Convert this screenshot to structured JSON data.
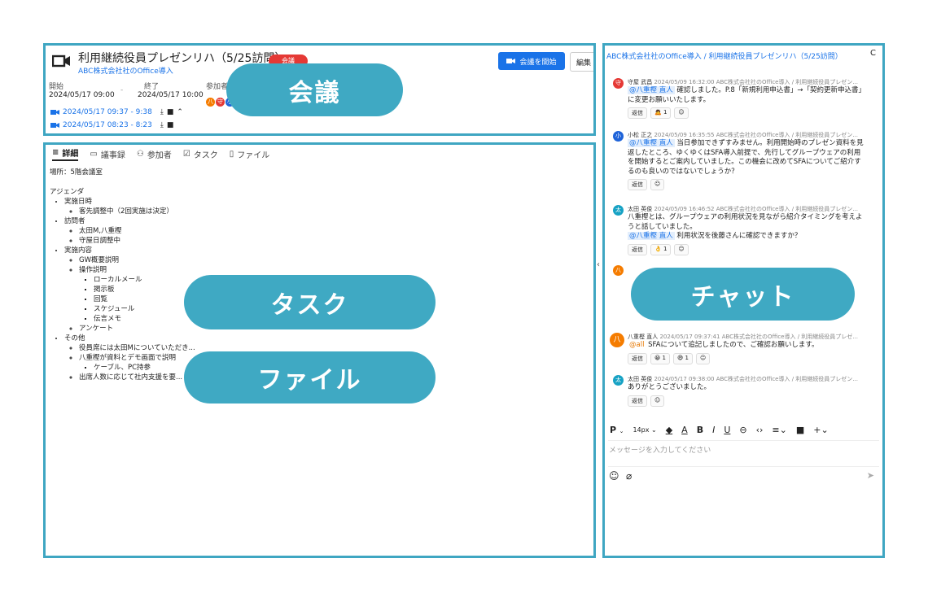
{
  "meeting": {
    "title": "利用継続役員プレゼンリハ（5/25訪問）",
    "company_link": "ABC株式会社社のOffice導入",
    "badge": "会議",
    "start_button": "会議を開始",
    "edit_button": "編集",
    "start_label": "開始",
    "start_value": "2024/05/17 09:00",
    "end_label": "終了",
    "end_value": "2024/05/17 10:00",
    "participants_label": "参加者",
    "participant_avatars": [
      "八",
      "守",
      "小"
    ],
    "recordings": [
      "2024/05/17 09:37 - 9:38",
      "2024/05/17 08:23 - 8:23"
    ]
  },
  "tabs": [
    {
      "label": "詳細"
    },
    {
      "label": "議事録"
    },
    {
      "label": "参加者"
    },
    {
      "label": "タスク"
    },
    {
      "label": "ファイル"
    }
  ],
  "detail": {
    "location": "場所：5階会議室",
    "agenda_title": "アジェンダ",
    "items": {
      "a": "実施日時",
      "a1": "客先調整中（2回実施は決定）",
      "b": "訪問者",
      "b1": "太田M,八重樫",
      "b2": "守屋日調整中",
      "c": "実施内容",
      "c1": "GW概要説明",
      "c2": "操作説明",
      "c2a": "ローカルメール",
      "c2b": "掲示板",
      "c2c": "回覧",
      "c2d": "スケジュール",
      "c2e": "伝言メモ",
      "c3": "アンケート",
      "d": "その他",
      "d1": "役員席には太田Mについていただき...",
      "d2": "八重樫が資料とデモ画面で説明",
      "d2a": "ケーブル、PC持参",
      "d3": "出席人数に応じて社内支援を要..."
    }
  },
  "chat": {
    "breadcrumb": "ABC株式会社社のOffice導入 / 利用継続役員プレゼンリハ（5/25訪問）",
    "close_icon_text": "C",
    "messages": [
      {
        "avatar": "守",
        "color": "#e53935",
        "name": "守屋 武昌",
        "meta": "2024/05/09 16:32:00  ABC株式会社社のOffice導入 / 利用継続役員プレゼン...",
        "mention": "@八重樫 直人",
        "text": "確認しました。P.8「新規利用申込書」→「契約更新申込書」に変更お願いいたします。",
        "reactions": [
          "返信",
          "🙇 1",
          "☺"
        ]
      },
      {
        "avatar": "小",
        "color": "#1e63d9",
        "name": "小松 正之",
        "meta": "2024/05/09 16:35:55  ABC株式会社社のOffice導入 / 利用継続役員プレゼン...",
        "mention": "@八重樫 直人",
        "text": "当日参加できずすみません。利用開始時のプレゼン資料を見返したところ、ゆくゆくはSFA導入前提で、先行してグループウェアの利用を開始するとご案内していました。この機会に改めてSFAについてご紹介するのも良いのではないでしょうか？",
        "reactions": [
          "返信",
          "☺"
        ]
      },
      {
        "avatar": "太",
        "color": "#17a2c4",
        "name": "太田 英俊",
        "meta": "2024/05/09 16:46:52  ABC株式会社社のOffice導入 / 利用継続役員プレゼン...",
        "text": "八重樫とは、グループウェアの利用状況を見ながら紹介タイミングを考えようと話していました。",
        "mention": "@八重樫 直人",
        "text2": "利用状況を後藤さんに確認できますか？",
        "reactions": [
          "返信",
          "👌 1",
          "☺"
        ]
      },
      {
        "avatar": "八",
        "color": "#f57c00",
        "name": "八重樫 直人",
        "meta": "2024/05/17 09:37:41  ABC株式会社社のOffice導入 / 利用継続役員プレゼ...",
        "mention": "@all",
        "text": "SFAについて追記しましたので、ご確認お願いします。",
        "reactions": [
          "返信",
          "😀 1",
          "😄 1",
          "☺"
        ]
      },
      {
        "avatar": "太",
        "color": "#17a2c4",
        "name": "太田 英俊",
        "meta": "2024/05/17 09:38:00  ABC株式会社社のOffice導入 / 利用継続役員プレゼン...",
        "text": "ありがとうございました。",
        "reactions": [
          "返信",
          "☺"
        ]
      }
    ],
    "editor": {
      "font_size": "14px",
      "placeholder": "メッセージを入力してください"
    }
  },
  "overlays": {
    "meeting": "会議",
    "task": "タスク",
    "file": "ファイル",
    "chat": "チャット"
  }
}
